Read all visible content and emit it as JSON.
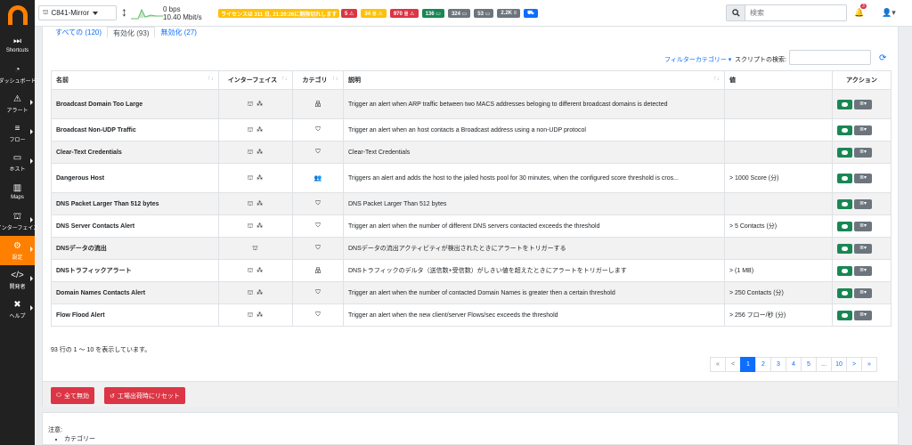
{
  "sidebar": {
    "items": [
      {
        "label": "Shortcuts",
        "icon": "fast-forward-icon",
        "glyph": "⏭"
      },
      {
        "label": "ダッシュボード",
        "icon": "dashboard-icon",
        "glyph": "◔"
      },
      {
        "label": "アラート",
        "icon": "warning-icon",
        "glyph": "⚠"
      },
      {
        "label": "フロー",
        "icon": "stream-icon",
        "glyph": "≡"
      },
      {
        "label": "ホスト",
        "icon": "laptop-icon",
        "glyph": "▭"
      },
      {
        "label": "Maps",
        "icon": "map-icon",
        "glyph": "▥"
      },
      {
        "label": "インターフェイス",
        "icon": "ethernet-icon",
        "glyph": "⛫"
      },
      {
        "label": "設定",
        "icon": "cog-icon",
        "glyph": "⚙"
      },
      {
        "label": "開発者",
        "icon": "code-icon",
        "glyph": "</>"
      },
      {
        "label": "ヘルプ",
        "icon": "help-icon",
        "glyph": "✖"
      }
    ]
  },
  "topbar": {
    "interface": "C841-Mirror",
    "traffic_up": "0 bps",
    "traffic_down": "10.40 Mbit/s",
    "license": "ライセンスは 311 日, 21:20:26に期限切れします",
    "badges": [
      {
        "text": "5 ⚠",
        "color": "#dc3545"
      },
      {
        "text": "34 ≣ ⚠",
        "color": "#ffc107"
      },
      {
        "text": "970 ≣ ⚠",
        "color": "#dc3545"
      },
      {
        "text": "136 ▭",
        "color": "#198754"
      },
      {
        "text": "324 ▭",
        "color": "#6c757d"
      },
      {
        "text": "53 ▭",
        "color": "#6c757d"
      },
      {
        "text": "2.2K ≡",
        "color": "#6c757d"
      },
      {
        "text": "⛟",
        "color": "#0d6efd"
      }
    ],
    "search_placeholder": "検索",
    "bell_count": "3"
  },
  "tabs": [
    {
      "label": "すべての (120)"
    },
    {
      "label": "有効化 (93)"
    },
    {
      "label": "無効化 (27)"
    }
  ],
  "filter_category": "フィルターカテゴリー ▾",
  "script_search_label": "スクリプトの検索:",
  "table": {
    "headers": [
      "名前",
      "インターフェイス",
      "カテゴリ",
      "説明",
      "値",
      "アクション"
    ],
    "rows": [
      {
        "name": "Broadcast Domain Too Large",
        "iface": "⛫ ⁂",
        "cat": "品",
        "desc": "Trigger an alert when ARP traffic between two MACS addresses beloging to different broadcast domains is detected",
        "value": ""
      },
      {
        "name": "Broadcast Non-UDP Traffic",
        "iface": "⛫ ⁂",
        "cat": "⛉",
        "desc": "Trigger an alert when an host contacts a Broadcast address using a non-UDP protocol",
        "value": ""
      },
      {
        "name": "Clear-Text Credentials",
        "iface": "⛫ ⁂",
        "cat": "⛉",
        "desc": "Clear-Text Credentials",
        "value": ""
      },
      {
        "name": "Dangerous Host",
        "iface": "⛫ ⁂",
        "cat": "👥",
        "desc": "Triggers an alert and adds the host to the jailed hosts pool for 30 minutes, when the configured score threshold is cros...",
        "value": "> 1000 Score (分)"
      },
      {
        "name": "DNS Packet Larger Than 512 bytes",
        "iface": "⛫ ⁂",
        "cat": "⛉",
        "desc": "DNS Packet Larger Than 512 bytes",
        "value": ""
      },
      {
        "name": "DNS Server Contacts Alert",
        "iface": "⛫ ⁂",
        "cat": "⛉",
        "desc": "Trigger an alert when the number of different DNS servers contacted exceeds the threshold",
        "value": "> 5 Contacts (分)"
      },
      {
        "name": "DNSデータの流出",
        "iface": "⛫",
        "cat": "⛉",
        "desc": "DNSデータの流出アクティビティが検出されたときにアラートをトリガーする",
        "value": ""
      },
      {
        "name": "DNSトラフィックアラート",
        "iface": "⛫ ⁂",
        "cat": "品",
        "desc": "DNSトラフィックのデルタ（送信数+受信数）がしきい値を超えたときにアラートをトリガーします",
        "value": "> (1 MB)"
      },
      {
        "name": "Domain Names Contacts Alert",
        "iface": "⛫ ⁂",
        "cat": "⛉",
        "desc": "Trigger an alert when the number of contacted Domain Names is greater then a certain threshold",
        "value": "> 250 Contacts (分)"
      },
      {
        "name": "Flow Flood Alert",
        "iface": "⛫ ⁂",
        "cat": "⛉",
        "desc": "Trigger an alert when the new client/server Flows/sec exceeds the threshold",
        "value": "> 256 フロー/秒 (分)"
      }
    ]
  },
  "showing": "93 行の 1 〜 10 を表示しています。",
  "pagination": [
    "«",
    "<",
    "1",
    "2",
    "3",
    "4",
    "5",
    "...",
    "10",
    ">",
    "»"
  ],
  "buttons": {
    "disable_all": "全て無効",
    "factory_reset": "工場出荷時にリセット"
  },
  "notes": {
    "title": "注意:",
    "item": "カテゴリー"
  }
}
